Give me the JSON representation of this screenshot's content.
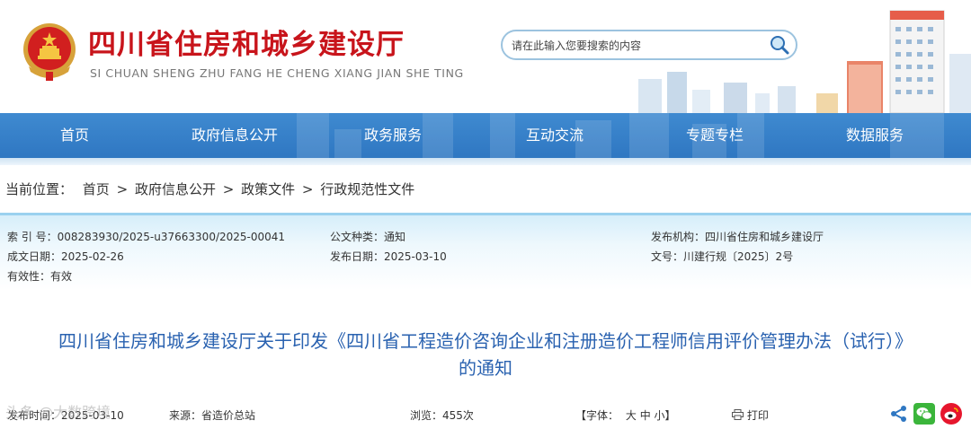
{
  "header": {
    "title": "四川省住房和城乡建设厅",
    "subtitle": "SI CHUAN SHENG ZHU FANG HE CHENG XIANG JIAN SHE TING",
    "search_placeholder": "请在此输入您要搜索的内容"
  },
  "nav": {
    "items": [
      "首页",
      "政府信息公开",
      "政务服务",
      "互动交流",
      "专题专栏",
      "数据服务"
    ]
  },
  "breadcrumb": {
    "label": "当前位置：",
    "items": [
      "首页",
      "政府信息公开",
      "政策文件",
      "行政规范性文件"
    ],
    "separator": ">"
  },
  "info": {
    "index_label": "索 引 号：",
    "index_value": "008283930/2025-u37663300/2025-00041",
    "doc_type_label": "公文种类：",
    "doc_type_value": "通知",
    "issuer_label": "发布机构：",
    "issuer_value": "四川省住房和城乡建设厅",
    "created_label": "成文日期：",
    "created_value": "2025-02-26",
    "published_label": "发布日期：",
    "published_value": "2025-03-10",
    "doc_no_label": "文号：",
    "doc_no_value": "川建行规〔2025〕2号",
    "validity_label": "有效性：",
    "validity_value": "有效"
  },
  "article": {
    "title_line1": "四川省住房和城乡建设厅关于印发《四川省工程造价咨询企业和注册造价工程师信用评价管理办法（试行）》",
    "title_line2": "的通知"
  },
  "meta": {
    "publish_time": "发布时间：2025-03-10",
    "source": "来源：省造价总站",
    "views": "浏览：455次",
    "font_label": "【字体：",
    "font_large": "大",
    "font_medium": "中",
    "font_small": "小】",
    "print_label": "打印"
  },
  "watermark": "头条 @大数跨境",
  "icons": {
    "search": "search-icon",
    "share": "share-icon",
    "wechat": "wechat-icon",
    "weibo": "weibo-icon",
    "print": "print-icon",
    "emblem": "national-emblem-icon"
  },
  "colors": {
    "title_red": "#c8141b",
    "nav_blue": "#3683cb",
    "article_title_blue": "#2a62b0",
    "wechat_green": "#3bb53b",
    "weibo_red": "#e6162d"
  }
}
